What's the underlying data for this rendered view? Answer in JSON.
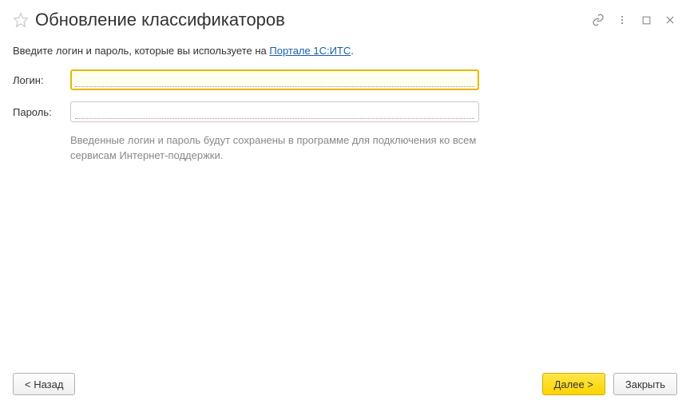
{
  "window": {
    "title": "Обновление классификаторов"
  },
  "intro": {
    "prefix": "Введите логин и пароль, которые вы используете на ",
    "link_text": "Портале 1С:ИТС",
    "suffix": "."
  },
  "form": {
    "login_label": "Логин:",
    "login_value": "",
    "password_label": "Пароль:",
    "password_value": ""
  },
  "hint": "Введенные логин и пароль будут сохранены в программе для подключения ко всем сервисам Интернет-поддержки.",
  "footer": {
    "back_label": "< Назад",
    "next_label": "Далее >",
    "close_label": "Закрыть"
  }
}
